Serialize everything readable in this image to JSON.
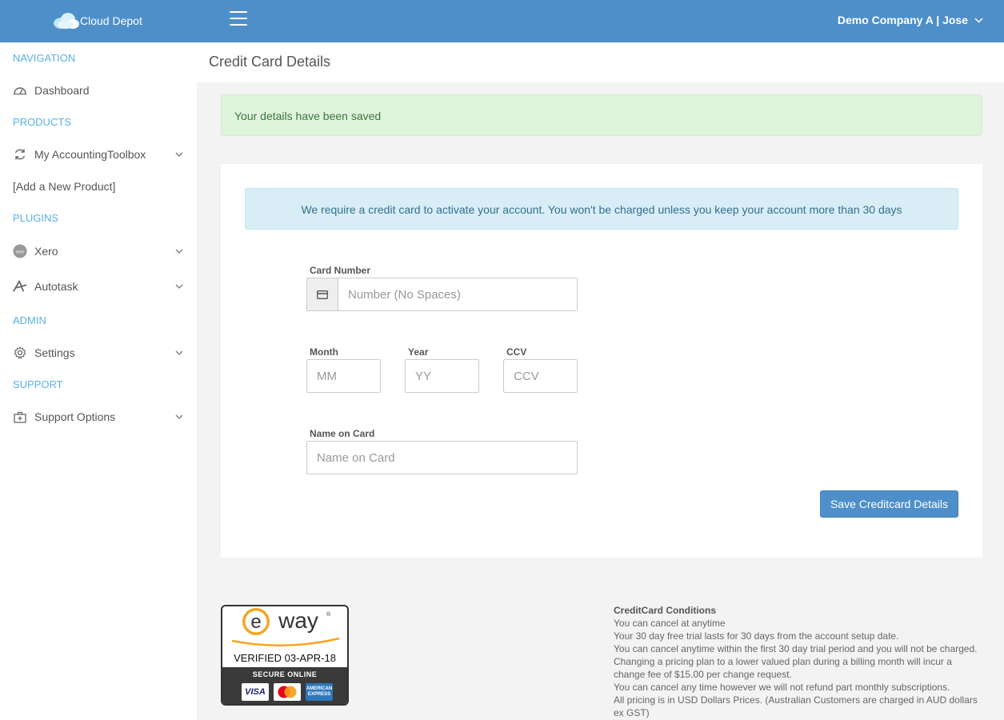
{
  "header": {
    "brand_name": "Cloud Depot",
    "user_label": "Demo Company A | Jose"
  },
  "sidebar": {
    "sections": {
      "navigation": "NAVIGATION",
      "products": "PRODUCTS",
      "plugins": "PLUGINS",
      "admin": "ADMIN",
      "support": "SUPPORT"
    },
    "items": {
      "dashboard": {
        "label": "Dashboard",
        "icon": "dashboard-icon"
      },
      "accounting_toolbox": {
        "label": "My AccountingToolbox",
        "icon": "sync-icon"
      },
      "add_product": "[Add a New Product]",
      "xero": {
        "label": "Xero",
        "icon": "xero-icon"
      },
      "autotask": {
        "label": "Autotask",
        "icon": "autotask-icon"
      },
      "settings": {
        "label": "Settings",
        "icon": "gear-icon"
      },
      "support_options": {
        "label": "Support Options",
        "icon": "medkit-icon"
      }
    }
  },
  "page": {
    "title": "Credit Card Details",
    "success_message": "Your details have been saved",
    "info_message": "We require a credit card to activate your account. You won't be charged unless you keep your account more than 30 days"
  },
  "form": {
    "card_number": {
      "label": "Card Number",
      "placeholder": "Number (No Spaces)",
      "value": ""
    },
    "month": {
      "label": "Month",
      "placeholder": "MM",
      "value": ""
    },
    "year": {
      "label": "Year",
      "placeholder": "YY",
      "value": ""
    },
    "ccv": {
      "label": "CCV",
      "placeholder": "CCV",
      "value": ""
    },
    "name_on_card": {
      "label": "Name on Card",
      "placeholder": "Name on Card",
      "value": ""
    },
    "save_button": "Save Creditcard Details"
  },
  "eway_badge": {
    "logo_text": "eway",
    "verified": "VERIFIED 03-APR-18",
    "secure": "SECURE ONLINE",
    "cards": [
      "VISA",
      "MasterCard",
      "AMERICAN EXPRESS"
    ]
  },
  "conditions": {
    "title": "CreditCard Conditions",
    "lines": [
      "You can cancel at anytime",
      "Your 30 day free trial lasts for 30 days from the account setup date.",
      "You can cancel anytime within the first 30 day trial period and you will not be charged.",
      "Changing a pricing plan to a lower valued plan during a billing month will incur a change fee of $15.00 per change request.",
      "You can cancel any time however we will not refund part monthly subscriptions.",
      "All pricing is in USD Dollars Prices. (Australian Customers are charged in AUD dollars ex GST)"
    ]
  },
  "colors": {
    "header_bg": "#4e8fc9",
    "section_heading": "#5ab0e6",
    "success_bg": "#dff4dc",
    "info_bg": "#d9edf7",
    "button_bg": "#4e8fc9"
  }
}
